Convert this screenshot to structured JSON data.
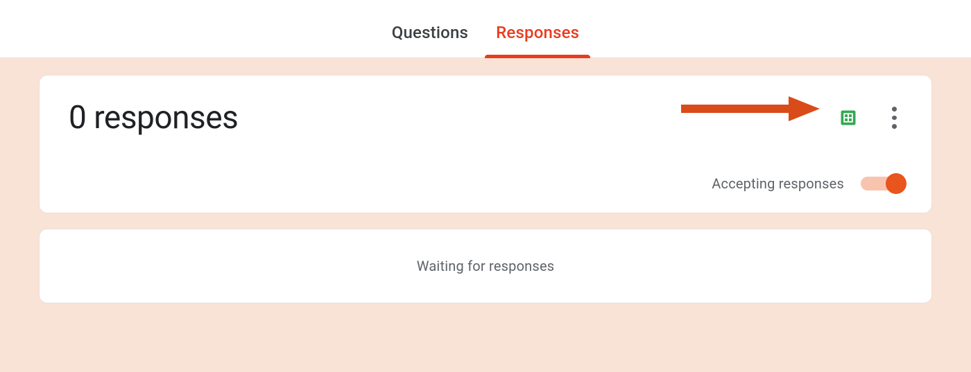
{
  "tabs": {
    "questions": "Questions",
    "responses": "Responses",
    "active": "responses"
  },
  "summary": {
    "title": "0 responses",
    "accepting_label": "Accepting responses",
    "accepting": true
  },
  "waiting": {
    "message": "Waiting for responses"
  },
  "colors": {
    "accent": "#ea3b1e",
    "body_bg": "#f9e3d6",
    "sheets_green": "#34a853",
    "toggle_on": "#e8551d",
    "arrow": "#d94c1a"
  }
}
